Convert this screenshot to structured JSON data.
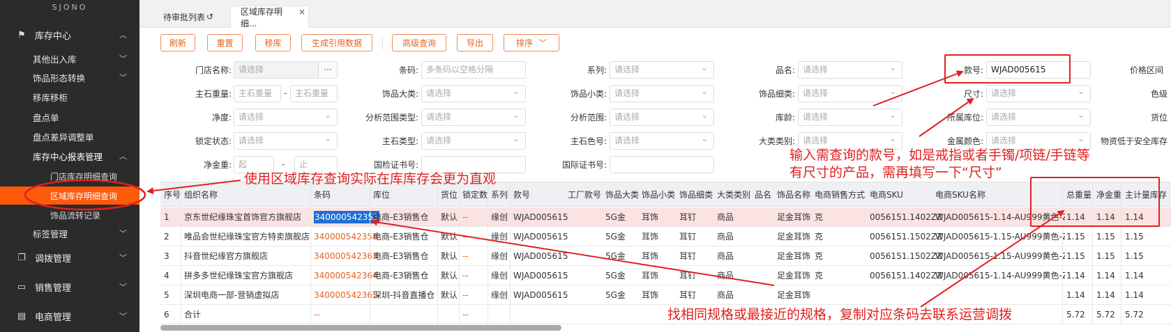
{
  "sidebar": {
    "logo": "SJONO",
    "inventory_center": "库存中心",
    "items": [
      "其他出入库",
      "饰品形态转换",
      "移库移柜",
      "盘点单",
      "盘点差异调整单"
    ],
    "report_group": "库存中心报表管理",
    "sub_items": [
      "门店库存明细查询",
      "区域库存明细查询",
      "饰品流转记录"
    ],
    "label_mgmt": "标签管理",
    "transfer_mgmt": "调拨管理",
    "sales_mgmt": "销售管理",
    "ecom_mgmt": "电商管理"
  },
  "tabs": [
    {
      "label": "待审批列表",
      "icon": "refresh-icon"
    },
    {
      "label": "区域库存明细...",
      "close": "×"
    }
  ],
  "toolbar": {
    "refresh": "刷新",
    "reset": "重置",
    "move": "移库",
    "gen": "生成引用数据",
    "advanced": "高级查询",
    "export": "导出",
    "sort": "排序"
  },
  "filters": {
    "store_name": "门店名称:",
    "placeholder_select": "请选择",
    "barcode": "条码:",
    "barcode_ph": "多条码以空格分隔",
    "series": "系列:",
    "product_name": "品名:",
    "style_no": "款号:",
    "style_no_value": "WJAD005615",
    "price_range": "价格区间",
    "main_stone_weight": "主石重量:",
    "main_stone_ph": "主石重量",
    "jewelry_big": "饰品大类:",
    "jewelry_small": "饰品小类:",
    "jewelry_fine": "饰品细类:",
    "size": "尺寸:",
    "color": "色级",
    "clarity": "净度:",
    "analysis_range_type": "分析范围类型:",
    "analysis_range": "分析范围:",
    "stock_age": "库龄:",
    "location": "所属库位:",
    "cargo": "货位",
    "lock_status": "锁定状态:",
    "main_stone_type": "主石类型:",
    "main_stone_color": "主石色号:",
    "big_category": "大类类别:",
    "metal_color": "金属颜色:",
    "below_safety": "物资低于安全库存",
    "net_gold": "净金重:",
    "from_ph": "起",
    "to_ph": "止",
    "cert_no": "国检证书号:",
    "intl_cert_no": "国际证书号:",
    "ellipsis": "···",
    "dash": "-"
  },
  "table": {
    "headers": [
      "序号",
      "组织名称",
      "条码",
      "库位",
      "货位",
      "锁定数",
      "系列",
      "款号",
      "工厂款号",
      "饰品大类",
      "饰品小类",
      "饰品细类",
      "大类类别",
      "品名",
      "饰品名称",
      "电商销售方式",
      "电商SKU",
      "电商SKU名称",
      "总重量",
      "净金重",
      "主计量库存"
    ],
    "rows": [
      {
        "no": "1",
        "org": "京东世纪缘珠宝首饰官方旗舰店",
        "code": "340000542353",
        "loc": "电商-E3销售仓",
        "slot": "默认",
        "lock": "--",
        "series": "缘创",
        "style": "WJAD005615",
        "big": "5G金",
        "small": "耳饰",
        "fine": "耳钉",
        "cat": "商品",
        "name": "足金耳饰",
        "mode": "克",
        "sku": "0056151.1402ZZ",
        "skuname": "WJAD005615-1.14-AU999黄色-ZZ",
        "w": "1.14",
        "nw": "1.14",
        "qty": "1.14"
      },
      {
        "no": "2",
        "org": "唯品会世纪缘珠宝官方特卖旗舰店",
        "code": "340000542358",
        "loc": "电商-E3销售仓",
        "slot": "默认",
        "lock": "--",
        "series": "缘创",
        "style": "WJAD005615",
        "big": "5G金",
        "small": "耳饰",
        "fine": "耳钉",
        "cat": "商品",
        "name": "足金耳饰",
        "mode": "克",
        "sku": "0056151.1502ZZ",
        "skuname": "WJAD005615-1.15-AU999黄色-ZZ",
        "w": "1.15",
        "nw": "1.15",
        "qty": "1.15"
      },
      {
        "no": "3",
        "org": "抖音世纪缘官方旗舰店",
        "code": "340000542363",
        "loc": "电商-E3销售仓",
        "slot": "默认",
        "lock": "--",
        "series": "缘创",
        "style": "WJAD005615",
        "big": "5G金",
        "small": "耳饰",
        "fine": "耳钉",
        "cat": "商品",
        "name": "足金耳饰",
        "mode": "克",
        "sku": "0056151.1502ZZ",
        "skuname": "WJAD005615-1.15-AU999黄色-ZZ",
        "w": "1.15",
        "nw": "1.15",
        "qty": "1.15"
      },
      {
        "no": "4",
        "org": "拼多多世纪缘珠宝官方旗舰店",
        "code": "340000542364",
        "loc": "电商-E3销售仓",
        "slot": "默认",
        "lock": "--",
        "series": "缘创",
        "style": "WJAD005615",
        "big": "5G金",
        "small": "耳饰",
        "fine": "耳钉",
        "cat": "商品",
        "name": "足金耳饰",
        "mode": "克",
        "sku": "0056151.1402ZZ",
        "skuname": "WJAD005615-1.14-AU999黄色-ZZ",
        "w": "1.14",
        "nw": "1.14",
        "qty": "1.14"
      },
      {
        "no": "5",
        "org": "深圳电商一部-营销虚拟店",
        "code": "340000542365",
        "loc": "深圳-抖音直播仓",
        "slot": "默认",
        "lock": "--",
        "series": "缘创",
        "style": "WJAD005615",
        "big": "5G金",
        "small": "耳饰",
        "fine": "耳钉",
        "cat": "商品",
        "name": "足金耳饰",
        "mode": "",
        "sku": "",
        "skuname": "",
        "w": "1.14",
        "nw": "1.14",
        "qty": "1.14"
      }
    ],
    "total": {
      "no": "6",
      "label": "合计",
      "code": "--",
      "lock": "--",
      "w": "5.72",
      "nw": "5.72",
      "qty": "5.72"
    }
  },
  "annotations": {
    "a1": "使用区域库存查询实际在库库存会更为直观",
    "a2_line1": "输入需查询的款号，如是戒指或者手镯/项链/手链等",
    "a2_line2": "有尺寸的产品，需再填写一下“尺寸”",
    "a3": "找相同规格或最接近的规格，复制对应条码去联系运营调拨",
    "color": "#e02020"
  }
}
